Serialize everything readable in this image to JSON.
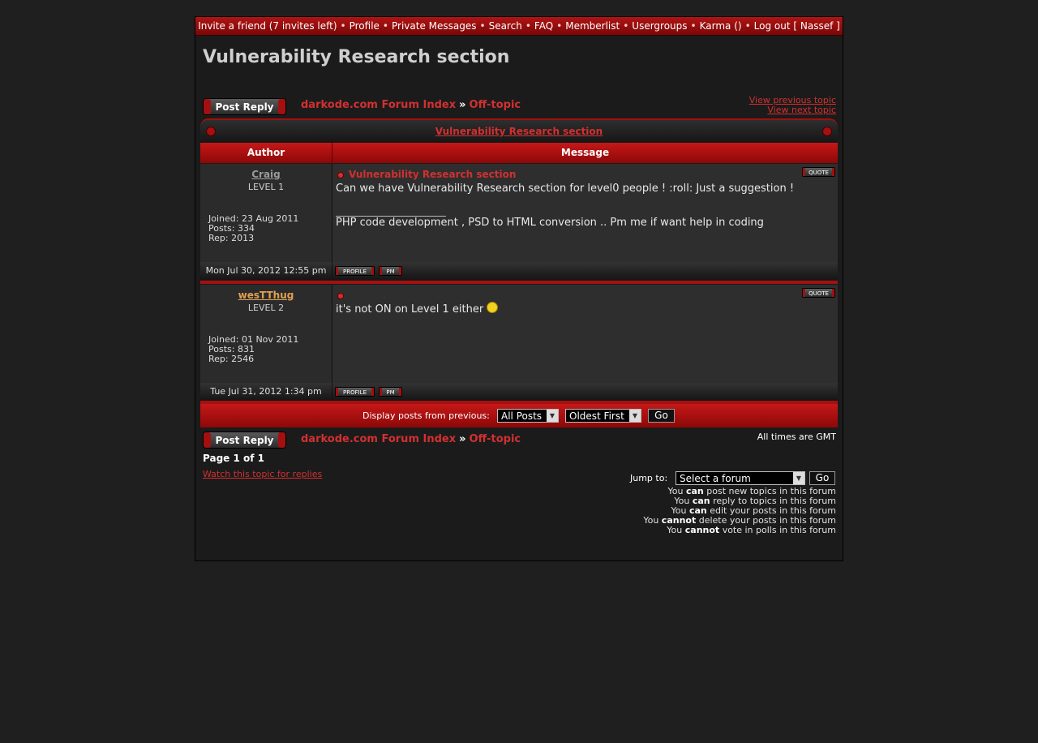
{
  "nav": {
    "items": [
      "Invite a friend (7 invites left)",
      "Profile",
      "Private Messages",
      "Search",
      "FAQ",
      "Memberlist",
      "Usergroups",
      "Karma ()",
      "Log out [ Nassef ]"
    ]
  },
  "page_title": "Vulnerability Research section",
  "post_reply_label": "Post Reply",
  "breadcrumb": {
    "index": "darkode.com Forum Index",
    "separator": "»",
    "forum": "Off-topic"
  },
  "prev_topic": "View previous topic",
  "next_topic": "View next topic",
  "topic_caption": "Vulnerability Research section",
  "headers": {
    "author": "Author",
    "message": "Message"
  },
  "quote_label": "QUOTE",
  "profile_label": "PROFILE",
  "pm_label": "PM",
  "posts": [
    {
      "author": "Craig",
      "level": "LEVEL 1",
      "joined": "Joined: 23 Aug 2011",
      "posts": "Posts: 334",
      "rep": "Rep: 2013",
      "title": "Vulnerability Research section",
      "text": "Can we have Vulnerability Research section for level0 people ! :roll: Just a suggestion !",
      "signature": "PHP code development , PSD to HTML conversion .. Pm me if want help in coding",
      "date": "Mon Jul 30, 2012 12:55 pm"
    },
    {
      "author": "wesTThug",
      "level": "LEVEL 2",
      "joined": "Joined: 01 Nov 2011",
      "posts": "Posts: 831",
      "rep": "Rep: 2546",
      "title": "",
      "text": "it's not ON on Level 1 either",
      "signature": "",
      "date": "Tue Jul 31, 2012 1:34 pm"
    }
  ],
  "display_options": {
    "label": "Display posts from previous:",
    "posts_select": "All Posts",
    "order_select": "Oldest First",
    "go": "Go"
  },
  "timezone_note": "All times are GMT",
  "pagination": "Page 1 of 1",
  "watch_link": "Watch this topic for replies",
  "jump": {
    "label": "Jump to:",
    "select": "Select a forum",
    "go": "Go"
  },
  "permissions": [
    {
      "pre": "You",
      "bold": "can",
      "post": "post new topics in this forum"
    },
    {
      "pre": "You",
      "bold": "can",
      "post": "reply to topics in this forum"
    },
    {
      "pre": "You",
      "bold": "can",
      "post": "edit your posts in this forum"
    },
    {
      "pre": "You",
      "bold": "cannot",
      "post": "delete your posts in this forum"
    },
    {
      "pre": "You",
      "bold": "cannot",
      "post": "vote in polls in this forum"
    }
  ],
  "colors": {
    "accent_red": "#d23030",
    "bar_red": "#b01414",
    "author1": "#9a9a9a",
    "author2": "#e0a050"
  }
}
